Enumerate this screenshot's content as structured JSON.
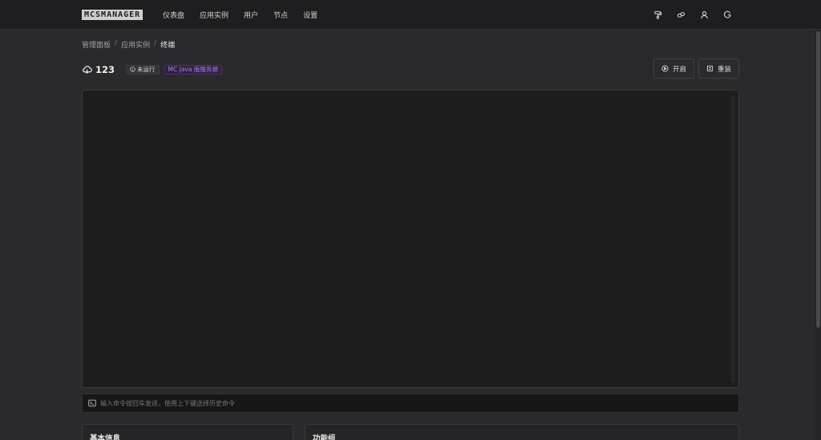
{
  "app": {
    "logo_text": "MCSMANAGER"
  },
  "nav": {
    "items": [
      "仪表盘",
      "应用实例",
      "用户",
      "节点",
      "设置"
    ]
  },
  "toolbar_icons": [
    "paint-roller-icon",
    "link-icon",
    "user-icon",
    "logout-icon"
  ],
  "breadcrumb": {
    "items": [
      "管理面板",
      "应用实例",
      "终端"
    ]
  },
  "instance": {
    "name": "123",
    "status": "未运行",
    "type": "MC Java 版服务端"
  },
  "actions": {
    "start_label": "开启",
    "reinstall_label": "重装"
  },
  "command": {
    "placeholder": "输入命令按回车发送，使用上下键选择历史命令",
    "value": ""
  },
  "cards": {
    "basic_info_title": "基本信息",
    "function_group_title": "功能组"
  },
  "colors": {
    "type_badge": "#a67be6",
    "background": "#2a2a2d",
    "terminal": "#1d1d1d"
  }
}
